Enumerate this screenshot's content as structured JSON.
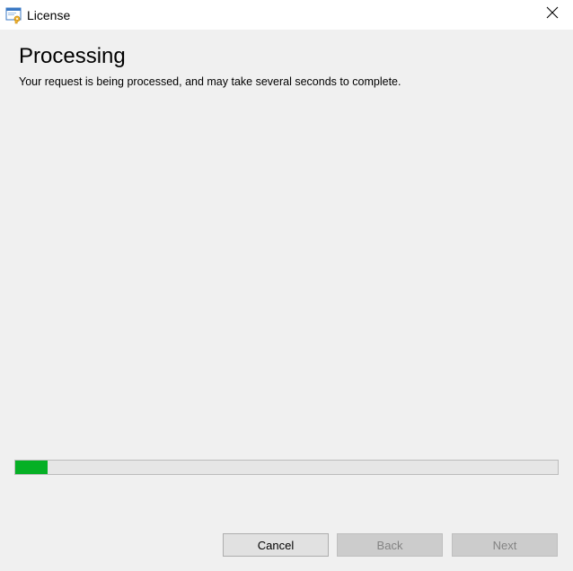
{
  "window": {
    "title": "License",
    "icon": "license-app-icon",
    "close_icon": "close-icon"
  },
  "content": {
    "heading": "Processing",
    "description": "Your request is being processed, and may take several seconds to complete."
  },
  "progress": {
    "value_percent": 6,
    "fill_color": "#06b025"
  },
  "buttons": {
    "cancel": "Cancel",
    "back": "Back",
    "next": "Next"
  }
}
